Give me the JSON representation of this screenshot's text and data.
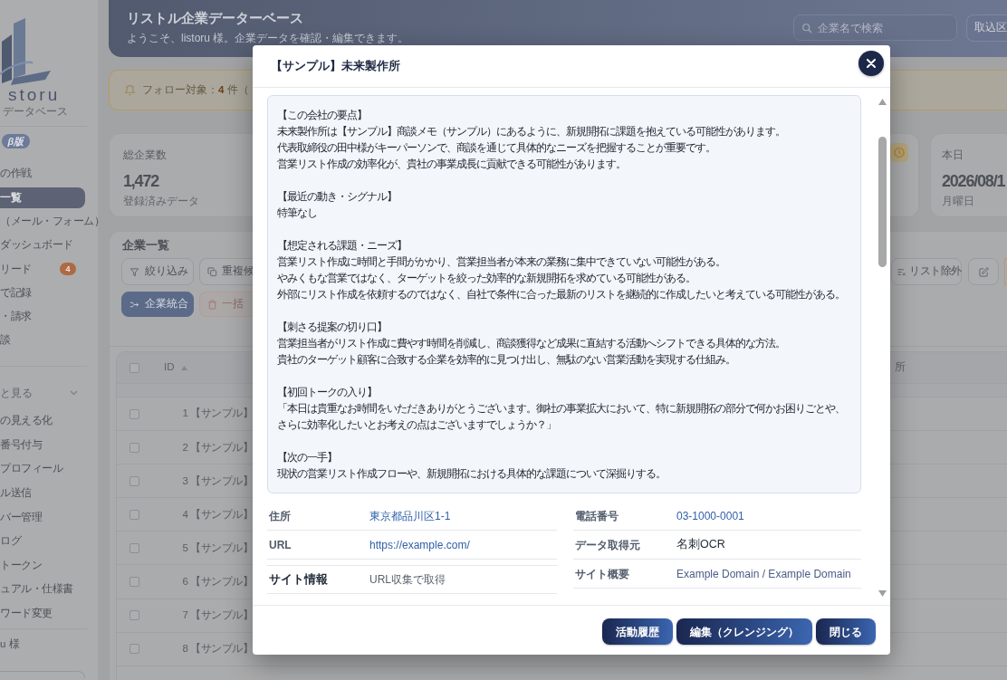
{
  "sidebar": {
    "logo_text": "storu",
    "logo_tagline": "データベース",
    "badge": "β版",
    "nav": [
      {
        "label": "の作戦",
        "selected": false
      },
      {
        "label": "一覧",
        "selected": true
      },
      {
        "label": "（メール・フォーム）",
        "selected": false
      },
      {
        "label": "ダッシュボード",
        "selected": false
      },
      {
        "label": "リード",
        "selected": false,
        "count": "4"
      },
      {
        "label": "で記録",
        "selected": false
      },
      {
        "label": "・請求",
        "selected": false
      },
      {
        "label": "談",
        "selected": false
      }
    ],
    "group": {
      "label": "と見る",
      "expanded": true,
      "items": [
        {
          "label": "の見える化",
          "selected": false
        },
        {
          "label": "番号付与",
          "selected": false
        },
        {
          "label": "プロフィール",
          "selected": false
        },
        {
          "label": "ル送信",
          "selected": false
        },
        {
          "label": "バー管理",
          "selected": false
        },
        {
          "label": "ログ",
          "selected": false
        },
        {
          "label": "トークン",
          "selected": false
        },
        {
          "label": "ュアル・仕様書",
          "selected": false
        },
        {
          "label": "ワード変更",
          "selected": false
        }
      ]
    },
    "user": "u 様"
  },
  "header": {
    "title": "リストル企業データーベース",
    "subtitle": "ようこそ、listoru 様。企業データを確認・編集できます。",
    "search": {
      "placeholder": "企業名で検索"
    },
    "import_button": "取込区"
  },
  "alert": {
    "text": "フォロー対象：**4** 件（"
  },
  "stats": [
    {
      "label": "総企業数",
      "value": "1,472",
      "note": "登録済みデータ"
    },
    {
      "label": "本日",
      "value": "2026/08/1",
      "note": "月曜日"
    }
  ],
  "companies": {
    "title": "企業一覧",
    "toolbar_rows": [
      [
        {
          "label": "絞り込み",
          "kind": "outline"
        },
        {
          "label": "重複候",
          "kind": "outline"
        }
      ],
      [
        {
          "label": "企業統合",
          "kind": "primary"
        },
        {
          "label": "一括",
          "kind": "danger"
        }
      ]
    ],
    "toolbar_right": {
      "label": "リスト除外"
    },
    "table": {
      "header_checked": false,
      "columns": [
        {
          "label": "ID",
          "sorted": true
        },
        {
          "label": "所",
          "sorted": false
        }
      ],
      "rows": [
        {
          "checked": false,
          "id": "1",
          "name": "【サンプル】"
        },
        {
          "checked": false,
          "id": "2",
          "name": "【サンプル】"
        },
        {
          "checked": false,
          "id": "3",
          "name": "【サンプル】"
        },
        {
          "checked": false,
          "id": "4",
          "name": "【サンプル】"
        },
        {
          "checked": false,
          "id": "5",
          "name": "【サンプル】"
        },
        {
          "checked": false,
          "id": "6",
          "name": "【サンプル】"
        },
        {
          "checked": false,
          "id": "7",
          "name": "【サンプル】"
        },
        {
          "checked": false,
          "id": "8",
          "name": "【サンプル】"
        }
      ]
    }
  },
  "modal": {
    "title": "【サンプル】未来製作所",
    "memo": [
      {
        "heading": "【この会社の要点】",
        "lines": [
          "未来製作所は【サンプル】商談メモ（サンプル）にあるように、新規開拓に課題を抱えている可能性があります。",
          "代表取締役の田中様がキーパーソンで、商談を通じて具体的なニーズを把握することが重要です。",
          "営業リスト作成の効率化が、貴社の事業成長に貢献できる可能性があります。"
        ]
      },
      {
        "heading": "【最近の動き・シグナル】",
        "lines": [
          "特筆なし"
        ]
      },
      {
        "heading": "【想定される課題・ニーズ】",
        "lines": [
          "営業リスト作成に時間と手間がかかり、営業担当者が本来の業務に集中できていない可能性がある。",
          "やみくもな営業ではなく、ターゲットを絞った効率的な新規開拓を求めている可能性がある。",
          "外部にリスト作成を依頼するのではなく、自社で条件に合った最新のリストを継続的に作成したいと考えている可能性がある。"
        ]
      },
      {
        "heading": "【刺さる提案の切り口】",
        "lines": [
          "営業担当者がリスト作成に費やす時間を削減し、商談獲得など成果に直結する活動へシフトできる具体的な方法。",
          "貴社のターゲット顧客に合致する企業を効率的に見つけ出し、無駄のない営業活動を実現する仕組み。"
        ]
      },
      {
        "heading": "【初回トークの入り】",
        "lines": [
          "「本日は貴重なお時間をいただきありがとうございます。御社の事業拡大において、特に新規開拓の部分で何かお困りごとや、さらに効率化したいとお考えの点はございますでしょうか？」"
        ]
      },
      {
        "heading": "【次の一手】",
        "lines": [
          "現状の営業リスト作成フローや、新規開拓における具体的な課題について深掘りする。"
        ]
      }
    ],
    "details": {
      "left": [
        {
          "label": "住所",
          "value": "東京都品川区1-1",
          "kind": "link",
          "emphasized": false
        },
        {
          "label": "URL",
          "value": "https://example.com/",
          "kind": "link",
          "emphasized": false
        },
        {
          "label": "サイト情報",
          "value": "URL収集で取得",
          "kind": "muted",
          "emphasized": true
        }
      ],
      "right": [
        {
          "label": "電話番号",
          "value": "03-1000-0001",
          "kind": "link",
          "emphasized": false
        },
        {
          "label": "データ取得元",
          "value": "名刺OCR",
          "kind": "text",
          "emphasized": false
        },
        {
          "label": "サイト概要",
          "value": "Example Domain / Example Domain",
          "kind": "summary",
          "emphasized": false
        }
      ]
    },
    "buttons": [
      "活動履歴",
      "編集（クレンジング）",
      "閉じる"
    ]
  }
}
